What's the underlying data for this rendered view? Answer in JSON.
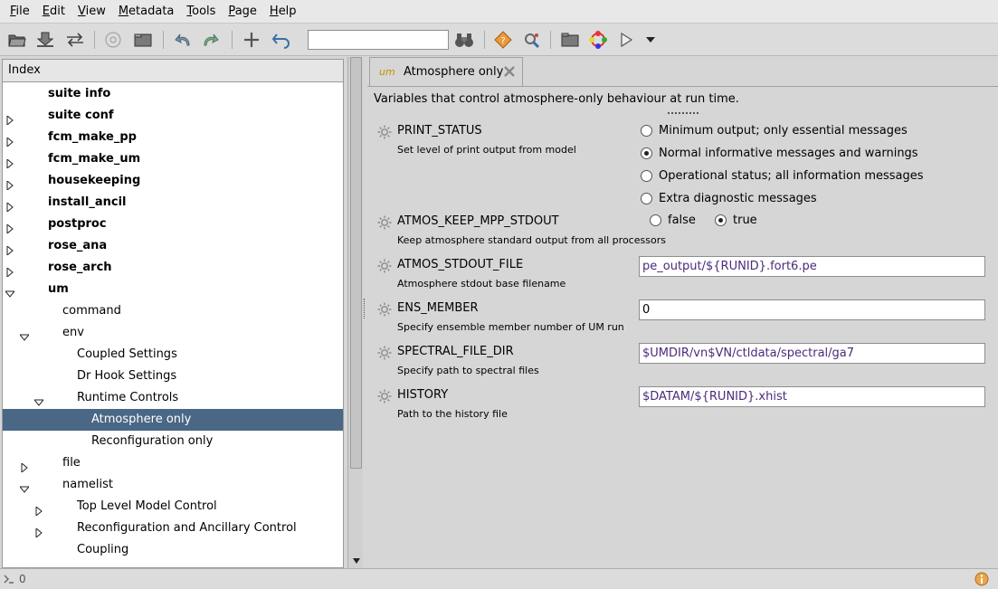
{
  "menubar": {
    "items": [
      {
        "label": "File",
        "u": "F",
        "rest": "ile"
      },
      {
        "label": "Edit",
        "u": "E",
        "rest": "dit"
      },
      {
        "label": "View",
        "u": "V",
        "rest": "iew"
      },
      {
        "label": "Metadata",
        "u": "M",
        "rest": "etadata"
      },
      {
        "label": "Tools",
        "u": "T",
        "rest": "ools"
      },
      {
        "label": "Page",
        "u": "P",
        "rest": "age"
      },
      {
        "label": "Help",
        "u": "H",
        "rest": "elp"
      }
    ]
  },
  "toolbar": {
    "search_value": ""
  },
  "index": {
    "header": "Index",
    "rows": [
      {
        "label": "suite info",
        "bold": true,
        "expander": "none",
        "depth": 0
      },
      {
        "label": "suite conf",
        "bold": true,
        "expander": "collapsed",
        "depth": 0
      },
      {
        "label": "fcm_make_pp",
        "bold": true,
        "expander": "collapsed",
        "depth": 0
      },
      {
        "label": "fcm_make_um",
        "bold": true,
        "expander": "collapsed",
        "depth": 0
      },
      {
        "label": "housekeeping",
        "bold": true,
        "expander": "collapsed",
        "depth": 0
      },
      {
        "label": "install_ancil",
        "bold": true,
        "expander": "collapsed",
        "depth": 0
      },
      {
        "label": "postproc",
        "bold": true,
        "expander": "collapsed",
        "depth": 0
      },
      {
        "label": "rose_ana",
        "bold": true,
        "expander": "collapsed",
        "depth": 0
      },
      {
        "label": "rose_arch",
        "bold": true,
        "expander": "collapsed",
        "depth": 0
      },
      {
        "label": "um",
        "bold": true,
        "expander": "expanded",
        "depth": 0
      },
      {
        "label": "command",
        "bold": false,
        "expander": "none",
        "depth": 1
      },
      {
        "label": "env",
        "bold": false,
        "expander": "expanded",
        "depth": 1
      },
      {
        "label": "Coupled Settings",
        "bold": false,
        "expander": "none",
        "depth": 2
      },
      {
        "label": "Dr Hook Settings",
        "bold": false,
        "expander": "none",
        "depth": 2
      },
      {
        "label": "Runtime Controls",
        "bold": false,
        "expander": "expanded",
        "depth": 2
      },
      {
        "label": "Atmosphere only",
        "bold": false,
        "expander": "none",
        "depth": 3,
        "selected": true
      },
      {
        "label": "Reconfiguration only",
        "bold": false,
        "expander": "none",
        "depth": 3
      },
      {
        "label": "file",
        "bold": false,
        "expander": "collapsed",
        "depth": 1
      },
      {
        "label": "namelist",
        "bold": false,
        "expander": "expanded",
        "depth": 1
      },
      {
        "label": "Top Level Model Control",
        "bold": false,
        "expander": "collapsed",
        "depth": 2
      },
      {
        "label": "Reconfiguration and Ancillary Control",
        "bold": false,
        "expander": "collapsed",
        "depth": 2
      },
      {
        "label": "Coupling",
        "bold": false,
        "expander": "none",
        "depth": 2
      }
    ]
  },
  "tab": {
    "prefix": "um",
    "title": "Atmosphere only"
  },
  "page": {
    "description": "Variables that control atmosphere-only behaviour at run time.",
    "variables": {
      "print_status": {
        "name": "PRINT_STATUS",
        "desc": "Set level of print output from model",
        "options": [
          {
            "label": "Minimum output; only essential messages",
            "checked": false
          },
          {
            "label": "Normal informative messages and warnings",
            "checked": true
          },
          {
            "label": "Operational status; all information messages",
            "checked": false
          },
          {
            "label": "Extra diagnostic messages",
            "checked": false
          }
        ]
      },
      "atmos_keep_mpp_stdout": {
        "name": "ATMOS_KEEP_MPP_STDOUT",
        "desc": "Keep atmosphere standard output from all processors",
        "options": [
          {
            "label": "false",
            "checked": false
          },
          {
            "label": "true",
            "checked": true
          }
        ]
      },
      "atmos_stdout_file": {
        "name": "ATMOS_STDOUT_FILE",
        "desc": "Atmosphere stdout base filename",
        "value": "pe_output/${RUNID}.fort6.pe"
      },
      "ens_member": {
        "name": "ENS_MEMBER",
        "desc": "Specify ensemble member number of UM run",
        "value": "0"
      },
      "spectral_file_dir": {
        "name": "SPECTRAL_FILE_DIR",
        "desc": "Specify path to spectral files",
        "value": "$UMDIR/vn$VN/ctldata/spectral/ga7"
      },
      "history": {
        "name": "HISTORY",
        "desc": "Path to the history file",
        "value": "$DATAM/${RUNID}.xhist"
      }
    }
  },
  "statusbar": {
    "count": "0"
  },
  "icons": {
    "toolbar": [
      "open-folder-icon",
      "load-icon",
      "transfer-icon",
      "find-icon",
      "folder-icon",
      "undo-icon",
      "redo-icon",
      "add-icon",
      "revert-icon",
      "binoculars-icon",
      "macro-icon",
      "transform-icon",
      "browse-icon",
      "graph-icon",
      "run-icon",
      "dropdown-icon"
    ],
    "colors": {
      "selected_row": "#4a6785",
      "field_text": "#4b2a7a",
      "tab_um": "#c09000"
    }
  }
}
